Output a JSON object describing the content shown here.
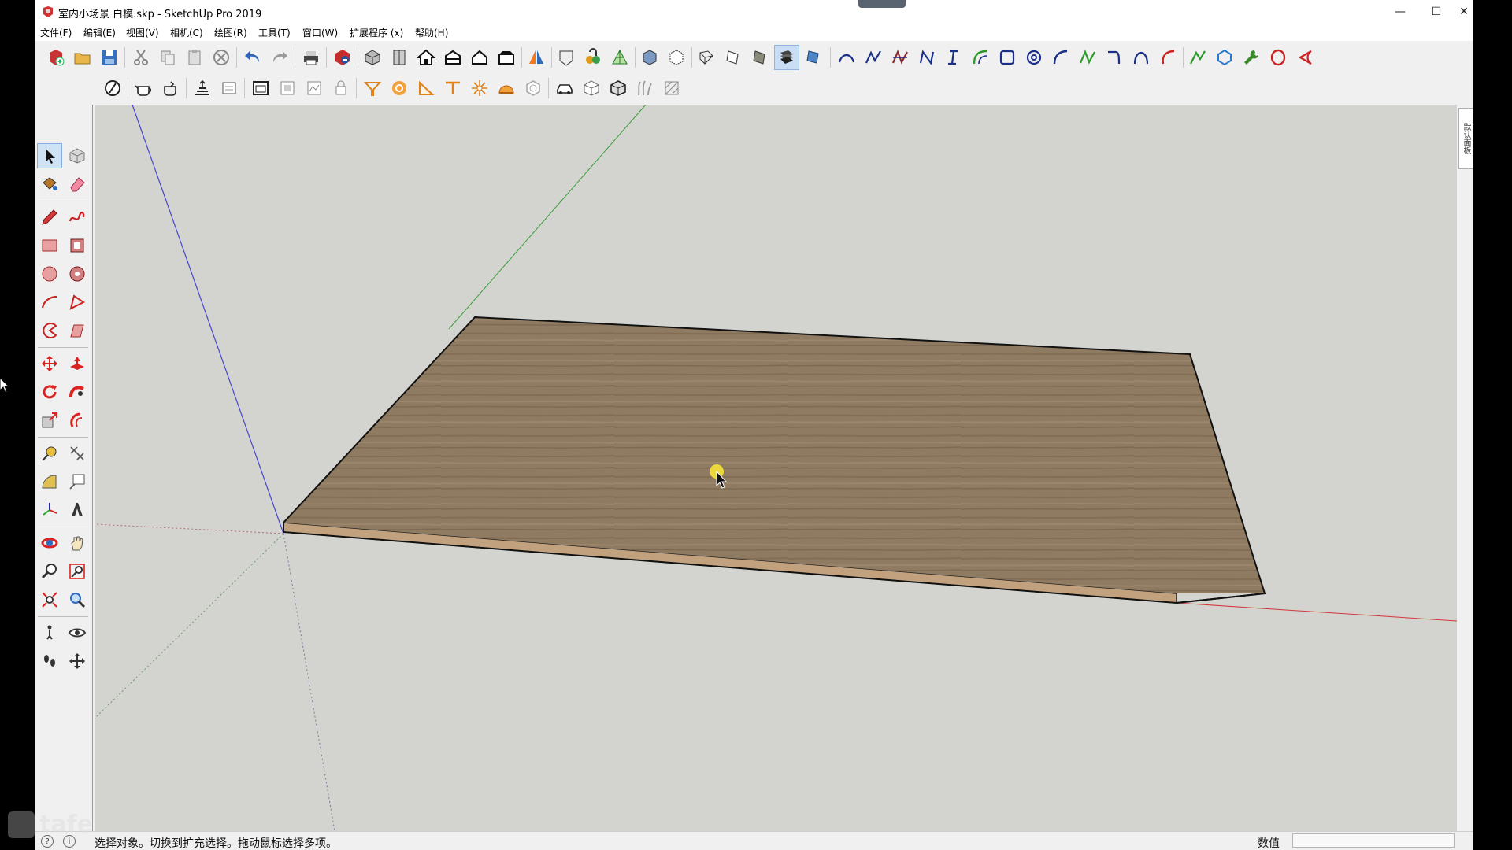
{
  "window": {
    "title": "室内小场景 白模.skp - SketchUp Pro 2019",
    "minimize_glyph": "—",
    "maximize_glyph": "☐",
    "close_glyph": "✕"
  },
  "menu": [
    {
      "label": "文件(F)"
    },
    {
      "label": "编辑(E)"
    },
    {
      "label": "视图(V)"
    },
    {
      "label": "相机(C)"
    },
    {
      "label": "绘图(R)"
    },
    {
      "label": "工具(T)"
    },
    {
      "label": "窗口(W)"
    },
    {
      "label": "扩展程序 (x)"
    },
    {
      "label": "帮助(H)"
    }
  ],
  "toolbar_row1": [
    "warehouse-add",
    "open-folder",
    "save",
    "cut",
    "copy",
    "paste",
    "erase-circle",
    "undo",
    "redo",
    "print",
    "sketchup-ruby",
    "views-iso",
    "views-top",
    "views-front",
    "views-right",
    "views-back",
    "views-left",
    "section-plane",
    "solid-outer-shell",
    "paint-buckets",
    "sandbox-tools",
    "style-xray",
    "style-backedges",
    "style-wireframe",
    "style-hidden-line",
    "style-shaded",
    "style-textured",
    "style-monochrome",
    "curve-arc",
    "curve-line",
    "curve-zigzag",
    "curve-n",
    "curve-i",
    "curve-green-arc",
    "curve-square",
    "curve-spiral",
    "curve-arc2",
    "curve-green-line",
    "curve-hook",
    "curve-arc3",
    "curve-red-arc",
    "curve-v",
    "curve-polygon",
    "curve-wrench",
    "curve-red-circle",
    "curve-red-loop"
  ],
  "toolbar_row2": [
    "solid-tools",
    "teapot-a",
    "teapot-b",
    "layer-up",
    "layer-box",
    "frame-a",
    "frame-b",
    "frame-c",
    "lock",
    "plugin-1",
    "target-rings",
    "angle-tool",
    "t-tool",
    "sparkle",
    "dome",
    "hexagon",
    "car-tool",
    "cube-a",
    "cube-b",
    "grass",
    "shaded-cube"
  ],
  "left_toolbar": [
    "select",
    "component",
    "paint-bucket",
    "eraser",
    "pencil",
    "freehand",
    "rectangle",
    "rotated-rectangle",
    "circle",
    "polygon",
    "arc",
    "two-point-arc",
    "pie",
    "three-point-arc",
    "move",
    "push-pull",
    "rotate",
    "follow-me",
    "scale",
    "offset",
    "tape-measure",
    "dimension",
    "protractor",
    "text",
    "axes",
    "3d-text",
    "orbit",
    "pan",
    "zoom",
    "zoom-window",
    "zoom-extents",
    "previous-view",
    "position-camera",
    "look-around",
    "walk",
    "section"
  ],
  "left_toolbar_active": "select",
  "toolbar_active": "style-shaded",
  "tray_tab": "默认面板",
  "status": {
    "hint": "选择对象。切换到扩充选择。拖动鼠标选择多项。",
    "vcb_label": "数值",
    "vcb_value": ""
  },
  "watermark": "tafe",
  "colors": {
    "viewport_bg": "#d3d3d0",
    "axis_red": "#d23a3a",
    "axis_green": "#3aa03a",
    "axis_blue": "#4040c8",
    "wood_top": "#8f7961",
    "wood_edge": "#c2a27e",
    "select_active": "#c9def5"
  }
}
